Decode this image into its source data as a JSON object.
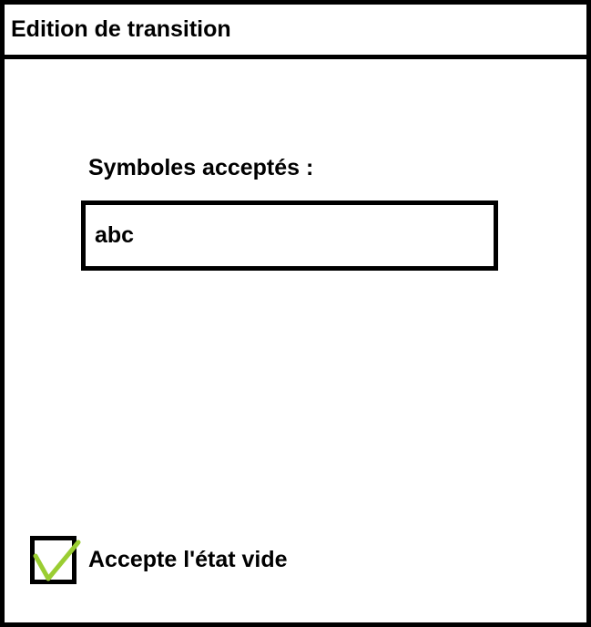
{
  "window": {
    "title": "Edition de transition"
  },
  "symbols": {
    "label": "Symboles acceptés :",
    "value": "abc"
  },
  "empty_state": {
    "label": "Accepte l'état vide",
    "checked": true,
    "icon": "checkmark-icon"
  },
  "colors": {
    "checkmark": "#9ACD32",
    "border": "#000000",
    "background": "#FFFFFF"
  }
}
